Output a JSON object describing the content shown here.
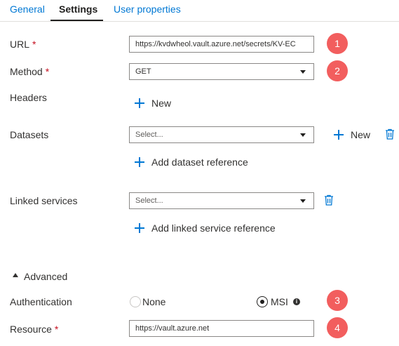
{
  "tabs": [
    {
      "label": "General"
    },
    {
      "label": "Settings"
    },
    {
      "label": "User properties"
    }
  ],
  "url": {
    "label": "URL",
    "required_mark": "*",
    "value": "https://kvdwheol.vault.azure.net/secrets/KV-EC"
  },
  "method": {
    "label": "Method",
    "required_mark": "*",
    "value": "GET"
  },
  "headers": {
    "label": "Headers",
    "new_label": "New"
  },
  "datasets": {
    "label": "Datasets",
    "placeholder": "Select...",
    "new_label": "New",
    "add_label": "Add dataset reference"
  },
  "linked_services": {
    "label": "Linked services",
    "placeholder": "Select...",
    "add_label": "Add linked service reference"
  },
  "advanced": {
    "label": "Advanced"
  },
  "authentication": {
    "label": "Authentication",
    "options": [
      {
        "label": "None",
        "selected": false
      },
      {
        "label": "MSI",
        "selected": true
      }
    ],
    "info_glyph": "i"
  },
  "resource": {
    "label": "Resource",
    "required_mark": "*",
    "value": "https://vault.azure.net"
  },
  "badges": [
    "1",
    "2",
    "3",
    "4"
  ],
  "icons": {
    "add": "plus-icon",
    "delete": "trash-icon",
    "dropdown": "chevron-down-icon",
    "collapse": "triangle-up-icon",
    "info": "info-icon"
  },
  "colors": {
    "accent": "#0078d4",
    "badge": "#f25e5e",
    "required": "#c50f1f",
    "text": "#323130"
  }
}
